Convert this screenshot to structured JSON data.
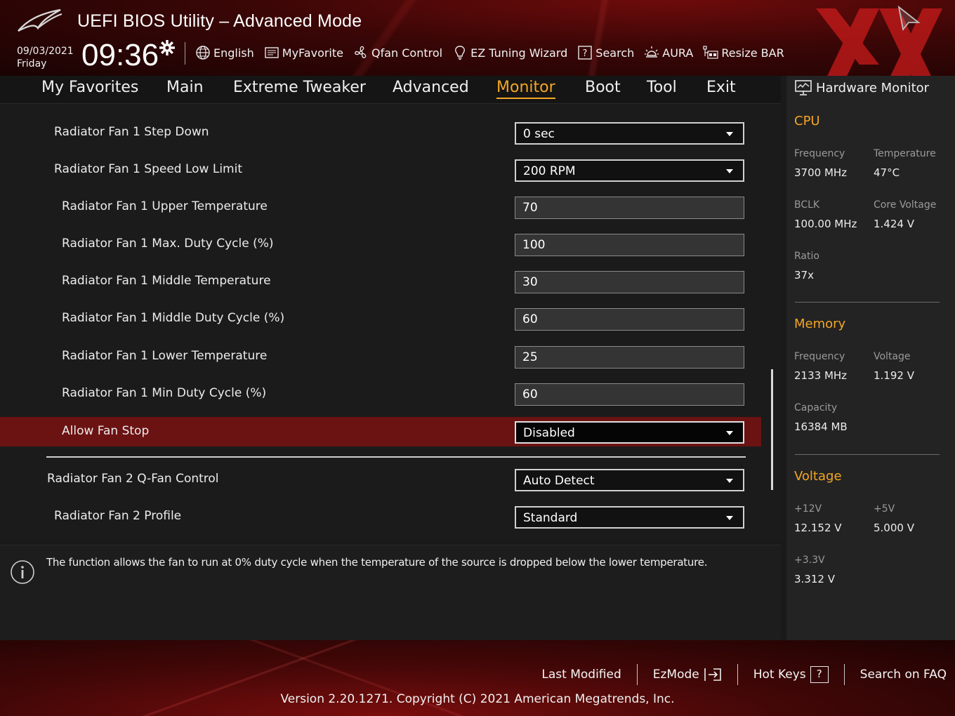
{
  "app": {
    "title": "UEFI BIOS Utility – Advanced Mode"
  },
  "datetime": {
    "date": "09/03/2021",
    "day": "Friday",
    "time": "09:36"
  },
  "toolbar": [
    {
      "label": "English",
      "icon": "globe-icon"
    },
    {
      "label": "MyFavorite",
      "icon": "favorite-icon"
    },
    {
      "label": "Qfan Control",
      "icon": "fan-icon"
    },
    {
      "label": "EZ Tuning Wizard",
      "icon": "bulb-icon"
    },
    {
      "label": "Search",
      "icon": "search-icon"
    },
    {
      "label": "AURA",
      "icon": "aura-icon"
    },
    {
      "label": "Resize BAR",
      "icon": "resize-bar-icon"
    }
  ],
  "tabs": [
    {
      "label": "My Favorites"
    },
    {
      "label": "Main"
    },
    {
      "label": "Extreme Tweaker"
    },
    {
      "label": "Advanced"
    },
    {
      "label": "Monitor",
      "active": true
    },
    {
      "label": "Boot"
    },
    {
      "label": "Tool"
    },
    {
      "label": "Exit"
    }
  ],
  "settings": [
    {
      "label": "Radiator Fan 1 Step Down",
      "value": "0 sec",
      "type": "select"
    },
    {
      "label": "Radiator Fan 1 Speed Low Limit",
      "value": "200 RPM",
      "type": "select"
    },
    {
      "label": "Radiator Fan 1 Upper Temperature",
      "value": "70",
      "type": "input"
    },
    {
      "label": "Radiator Fan 1 Max. Duty Cycle (%)",
      "value": "100",
      "type": "input"
    },
    {
      "label": "Radiator Fan 1 Middle Temperature",
      "value": "30",
      "type": "input"
    },
    {
      "label": "Radiator Fan 1 Middle Duty Cycle (%)",
      "value": "60",
      "type": "input"
    },
    {
      "label": "Radiator Fan 1 Lower Temperature",
      "value": "25",
      "type": "input"
    },
    {
      "label": "Radiator Fan 1 Min Duty Cycle (%)",
      "value": "60",
      "type": "input"
    },
    {
      "label": "Allow Fan Stop",
      "value": "Disabled",
      "type": "select",
      "selected": true
    },
    {
      "label": "Radiator Fan 2 Q-Fan Control",
      "value": "Auto Detect",
      "type": "select"
    },
    {
      "label": "Radiator Fan 2 Profile",
      "value": "Standard",
      "type": "select"
    }
  ],
  "help": {
    "text": "The function allows the fan to run at 0% duty cycle when the temperature of the source is dropped below the lower temperature."
  },
  "hardware_monitor": {
    "title": "Hardware Monitor",
    "cpu": {
      "heading": "CPU",
      "frequency_label": "Frequency",
      "frequency": "3700 MHz",
      "temperature_label": "Temperature",
      "temperature": "47°C",
      "bclk_label": "BCLK",
      "bclk": "100.00 MHz",
      "core_voltage_label": "Core Voltage",
      "core_voltage": "1.424 V",
      "ratio_label": "Ratio",
      "ratio": "37x"
    },
    "memory": {
      "heading": "Memory",
      "frequency_label": "Frequency",
      "frequency": "2133 MHz",
      "voltage_label": "Voltage",
      "voltage": "1.192 V",
      "capacity_label": "Capacity",
      "capacity": "16384 MB"
    },
    "voltage": {
      "heading": "Voltage",
      "v12_label": "+12V",
      "v12": "12.152 V",
      "v5_label": "+5V",
      "v5": "5.000 V",
      "v33_label": "+3.3V",
      "v33": "3.312 V"
    }
  },
  "footer": {
    "last_modified": "Last Modified",
    "ezmode": "EzMode",
    "hot_keys": "Hot Keys",
    "hot_keys_key": "?",
    "search_faq": "Search on FAQ",
    "version": "Version 2.20.1271. Copyright (C) 2021 American Megatrends, Inc."
  },
  "colors": {
    "accent": "#f5a623",
    "selected_row": "#6b1212",
    "header_red": "#6e0b0b"
  }
}
